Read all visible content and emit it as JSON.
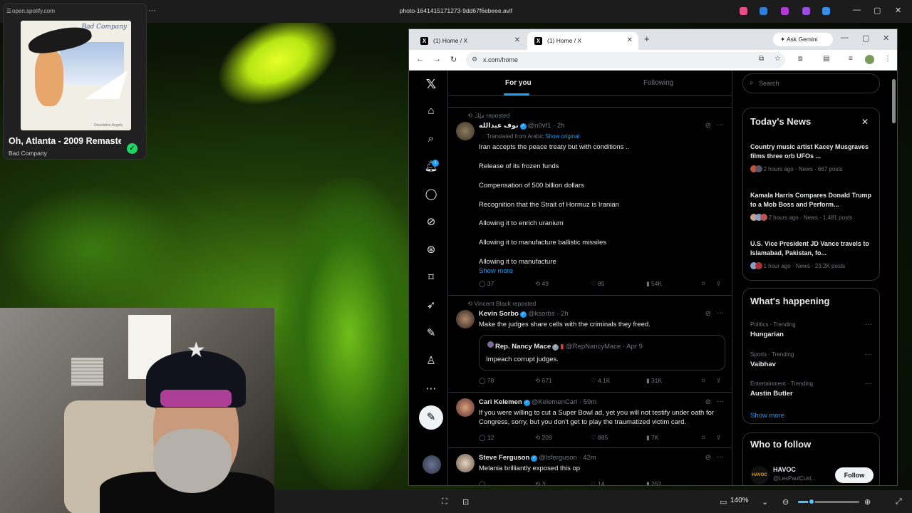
{
  "viewer": {
    "file_title": "photo-1641415171273-9dd67f6ebeee.avif",
    "zoom_level": "140%",
    "zoom_fraction": 0.22
  },
  "spotify": {
    "url": "open.spotify.com",
    "album_band": "Bad Company",
    "album_subtitle": "Desolation Angels",
    "song": "Oh, Atlanta - 2009 Remaster",
    "artist": "Bad Company"
  },
  "browser": {
    "tabs": [
      {
        "label": "(1) Home / X",
        "active": false
      },
      {
        "label": "(1) Home / X",
        "active": true
      }
    ],
    "ask_gemini": "Ask Gemini",
    "url": "x.com/home"
  },
  "x": {
    "notification_count": "1",
    "timeline_tabs": [
      "For you",
      "Following"
    ],
    "tweets": [
      {
        "repost_label": "ملِكَ reposted",
        "name": "نوف عبدالله",
        "handle": "@n0vf1 · 2h",
        "translated_label": "Translated from Arabic",
        "show_original": "Show original",
        "lines": [
          "Iran accepts the peace treaty but with conditions ..",
          "Release of its frozen funds",
          "Compensation of 500 billion dollars",
          "Recognition that the Strait of Hormuz is Iranian",
          "Allowing it to enrich uranium",
          "Allowing it to manufacture ballistic missiles",
          "Allowing it to manufacture"
        ],
        "show_more": "Show more",
        "replies": "37",
        "reposts": "49",
        "likes": "85",
        "views": "54K"
      },
      {
        "repost_label": "Vincent Black reposted",
        "name": "Kevin Sorbo",
        "handle": "@ksorbs · 2h",
        "text": "Make the judges share cells with the criminals they freed.",
        "quote_name": "Rep. Nancy Mace",
        "quote_handle": "@RepNancyMace · Apr 9",
        "quote_text": "Impeach corrupt judges.",
        "replies": "78",
        "reposts": "671",
        "likes": "4.1K",
        "views": "31K"
      },
      {
        "name": "Cari Kelemen",
        "handle": "@KelemenCarl · 59m",
        "text": "If you were willing to cut a Super Bowl ad, yet you will not testify under oath for Congress, sorry, but you don't get to play the traumatized victim card.",
        "replies": "12",
        "reposts": "209",
        "likes": "885",
        "views": "7K"
      },
      {
        "name": "Steve Ferguson",
        "handle": "@lsferguson · 42m",
        "text": "Melania brilliantly exposed this op",
        "reposts": "3",
        "likes": "14",
        "views": "252"
      }
    ],
    "sidebar": {
      "search_placeholder": "Search",
      "news_title": "Today's News",
      "news": [
        {
          "title": "Country music artist Kacey Musgraves films three orb UFOs ...",
          "meta": "2 hours ago · News · 667 posts"
        },
        {
          "title": "Kamala Harris Compares Donald Trump to a Mob Boss and Perform...",
          "meta": "2 hours ago · News · 1,481 posts"
        },
        {
          "title": "U.S. Vice President JD Vance travels to Islamabad, Pakistan, fo...",
          "meta": "1 hour ago · News · 23.2K posts"
        }
      ],
      "happening_title": "What's happening",
      "trends": [
        {
          "category": "Politics · Trending",
          "name": "Hungarian"
        },
        {
          "category": "Sports · Trending",
          "name": "Vaibhav"
        },
        {
          "category": "Entertainment · Trending",
          "name": "Austin Butler"
        }
      ],
      "show_more": "Show more",
      "follow_title": "Who to follow",
      "follow": {
        "avatar_text": "HAVOC",
        "name": "HAVOC",
        "handle": "@LesPaulCust...",
        "button": "Follow"
      }
    }
  },
  "colors": {
    "x_blue": "#1d9bf0",
    "spotify_green": "#1ed760",
    "viewer_accent": "#4cc2ff"
  }
}
